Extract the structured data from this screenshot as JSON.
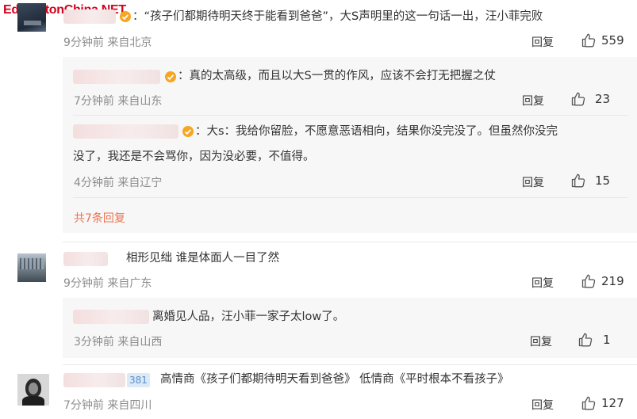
{
  "watermark": "EdmontonChina.NET",
  "comments": [
    {
      "text": "：“孩子们都期待明天终于能看到爸爸”，大S声明里的这一句话一出，汪小菲完败",
      "meta": "9分钟前 来自北京",
      "reply_label": "回复",
      "likes": "559",
      "replies": [
        {
          "text": "：真的太高级，而且以大S一贯的作风，应该不会打无把握之仗",
          "meta": "7分钟前 来自山东",
          "reply_label": "回复",
          "likes": "23"
        },
        {
          "text_line1": "：大s：我给你留脸，不愿意恶语相向，结果你没完没了。但虽然你没完",
          "text_line2": "没了，我还是不会骂你，因为没必要，不值得。",
          "meta": "4分钟前 来自辽宁",
          "reply_label": "回复",
          "likes": "15"
        }
      ],
      "more_replies": "共7条回复"
    },
    {
      "text": "相形见绌 谁是体面人一目了然",
      "meta": "9分钟前 来自广东",
      "reply_label": "回复",
      "likes": "219",
      "replies": [
        {
          "text": "离婚见人品，汪小菲一家子太low了。",
          "meta": "3分钟前 来自山西",
          "reply_label": "回复",
          "likes": "1"
        }
      ]
    },
    {
      "mention_tail": "381",
      "text": "高情商《孩子们都期待明天看到爸爸》 低情商《平时根本不看孩子》",
      "meta": "7分钟前 来自四川",
      "reply_label": "回复",
      "likes": "127"
    }
  ],
  "colors": {
    "accent": "#eb7350",
    "meta": "#8c8c8c",
    "subbox": "#f7f7f7",
    "watermark": "#d0021b"
  },
  "icons": {
    "like": "thumbs-up-icon",
    "verified": "verified-badge-icon"
  }
}
